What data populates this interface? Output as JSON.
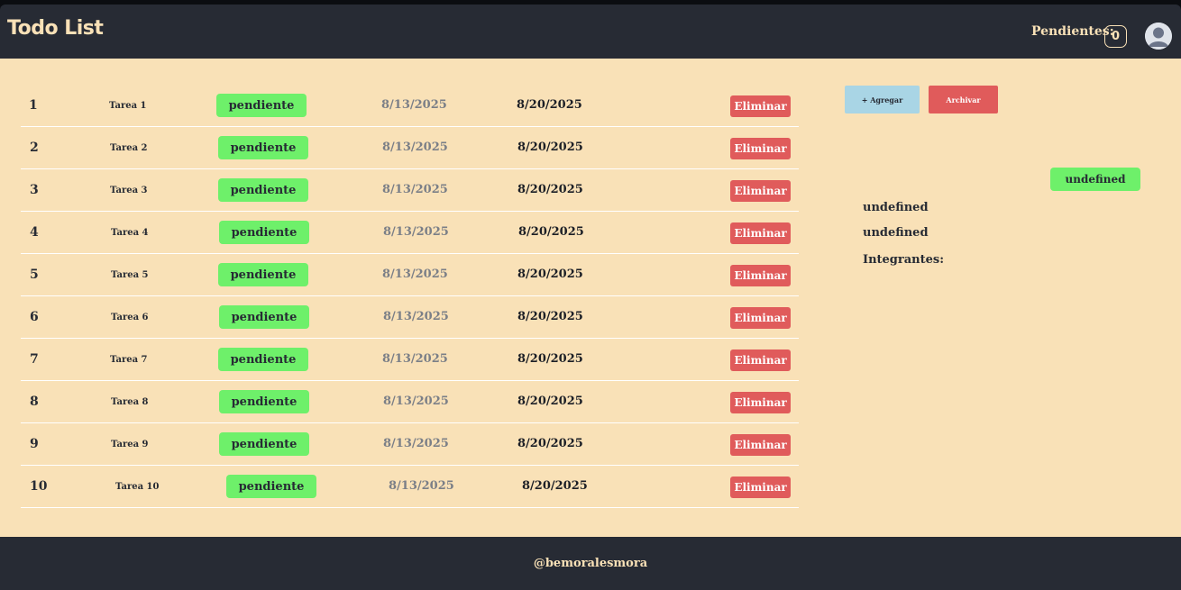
{
  "header": {
    "title": "Todo List",
    "pending_label": "Pendientes:",
    "pending_count": "0",
    "avatar_icon": "user-avatar-icon"
  },
  "tasks": [
    {
      "id": "1",
      "name": "Tarea 1",
      "status": "pendiente",
      "created": "8/13/2025",
      "due": "8/20/2025",
      "delete_label": "Eliminar"
    },
    {
      "id": "2",
      "name": "Tarea 2",
      "status": "pendiente",
      "created": "8/13/2025",
      "due": "8/20/2025",
      "delete_label": "Eliminar"
    },
    {
      "id": "3",
      "name": "Tarea 3",
      "status": "pendiente",
      "created": "8/13/2025",
      "due": "8/20/2025",
      "delete_label": "Eliminar"
    },
    {
      "id": "4",
      "name": "Tarea 4",
      "status": "pendiente",
      "created": "8/13/2025",
      "due": "8/20/2025",
      "delete_label": "Eliminar"
    },
    {
      "id": "5",
      "name": "Tarea 5",
      "status": "pendiente",
      "created": "8/13/2025",
      "due": "8/20/2025",
      "delete_label": "Eliminar"
    },
    {
      "id": "6",
      "name": "Tarea 6",
      "status": "pendiente",
      "created": "8/13/2025",
      "due": "8/20/2025",
      "delete_label": "Eliminar"
    },
    {
      "id": "7",
      "name": "Tarea 7",
      "status": "pendiente",
      "created": "8/13/2025",
      "due": "8/20/2025",
      "delete_label": "Eliminar"
    },
    {
      "id": "8",
      "name": "Tarea 8",
      "status": "pendiente",
      "created": "8/13/2025",
      "due": "8/20/2025",
      "delete_label": "Eliminar"
    },
    {
      "id": "9",
      "name": "Tarea 9",
      "status": "pendiente",
      "created": "8/13/2025",
      "due": "8/20/2025",
      "delete_label": "Eliminar"
    },
    {
      "id": "10",
      "name": "Tarea 10",
      "status": "pendiente",
      "created": "8/13/2025",
      "due": "8/20/2025",
      "delete_label": "Eliminar"
    }
  ],
  "actions": {
    "add_label": "+ Agregar",
    "archive_label": "Archivar"
  },
  "detail": {
    "status": "undefined",
    "line1": "undefined",
    "line2": "undefined",
    "members_label": "Integrantes:"
  },
  "footer": {
    "text": "@bemoralesmora"
  },
  "colors": {
    "header_bg": "#272b34",
    "main_bg": "#f9e1b7",
    "status_green": "#6ef06a",
    "delete_red": "#e05b5b",
    "add_blue": "#a9d5e5"
  }
}
